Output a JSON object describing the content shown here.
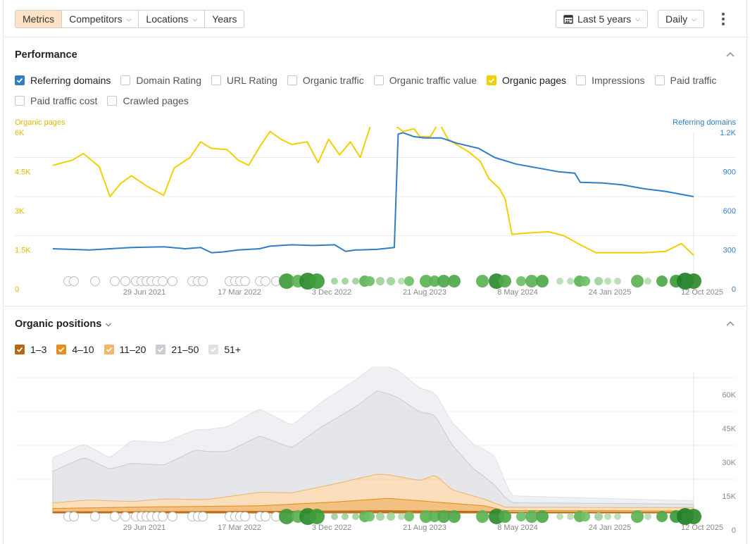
{
  "toolbar": {
    "tabs": [
      "Metrics",
      "Competitors",
      "Locations",
      "Years"
    ],
    "range_label": "Last 5 years",
    "interval_label": "Daily"
  },
  "performance": {
    "title": "Performance",
    "checkboxes": [
      {
        "label": "Referring domains",
        "checked": true,
        "color": "#2f7ec5"
      },
      {
        "label": "Domain Rating",
        "checked": false
      },
      {
        "label": "URL Rating",
        "checked": false
      },
      {
        "label": "Organic traffic",
        "checked": false
      },
      {
        "label": "Organic traffic value",
        "checked": false
      },
      {
        "label": "Organic pages",
        "checked": true,
        "color": "#f2cf00"
      },
      {
        "label": "Impressions",
        "checked": false
      },
      {
        "label": "Paid traffic",
        "checked": false
      },
      {
        "label": "Paid traffic cost",
        "checked": false
      },
      {
        "label": "Crawled pages",
        "checked": false
      }
    ]
  },
  "positions": {
    "title": "Organic positions",
    "legend": [
      {
        "label": "1–3",
        "color": "#b8660e"
      },
      {
        "label": "4–10",
        "color": "#e88e1c"
      },
      {
        "label": "11–20",
        "color": "#f7b56a"
      },
      {
        "label": "21–50",
        "color": "#c9ced6"
      },
      {
        "label": "51+",
        "color": "#dde1e7"
      }
    ]
  },
  "colors": {
    "organic_pages": "#f2cf00",
    "referring_domains": "#2f7ec5",
    "accent": "#fde3c4"
  },
  "chart_data": [
    {
      "type": "line",
      "left_axis_label": "Organic pages",
      "right_axis_label": "Referring domains",
      "x_tick_labels": [
        "29 Jun 2021",
        "17 Mar 2022",
        "3 Dec 2022",
        "21 Aug 2023",
        "8 May 2024",
        "24 Jan 2025",
        "12 Oct 2025"
      ],
      "y_left_ticks": [
        "0",
        "1.5K",
        "3K",
        "4.5K",
        "6K"
      ],
      "y_right_ticks": [
        "0",
        "300",
        "600",
        "900",
        "1.2K"
      ],
      "ylim_left": [
        0,
        6000
      ],
      "ylim_right": [
        0,
        1200
      ],
      "x_range": [
        "2020-10-20",
        "2025-10-20"
      ],
      "series": [
        {
          "name": "Organic pages",
          "axis": "left",
          "points": [
            [
              "2020-10-20",
              4200
            ],
            [
              "2020-12-15",
              4400
            ],
            [
              "2021-01-15",
              4650
            ],
            [
              "2021-03-01",
              4150
            ],
            [
              "2021-04-01",
              3000
            ],
            [
              "2021-05-01",
              3500
            ],
            [
              "2021-06-01",
              3800
            ],
            [
              "2021-07-15",
              3400
            ],
            [
              "2021-09-01",
              3050
            ],
            [
              "2021-10-01",
              4100
            ],
            [
              "2021-11-15",
              4500
            ],
            [
              "2021-12-15",
              5100
            ],
            [
              "2022-01-15",
              4850
            ],
            [
              "2022-03-01",
              4800
            ],
            [
              "2022-04-01",
              4400
            ],
            [
              "2022-05-01",
              4200
            ],
            [
              "2022-06-01",
              4900
            ],
            [
              "2022-07-01",
              5500
            ],
            [
              "2022-08-01",
              5200
            ],
            [
              "2022-09-01",
              5000
            ],
            [
              "2022-10-15",
              5100
            ],
            [
              "2022-11-15",
              4300
            ],
            [
              "2022-12-15",
              5200
            ],
            [
              "2023-01-15",
              4600
            ],
            [
              "2023-02-15",
              5100
            ],
            [
              "2023-03-15",
              4500
            ],
            [
              "2023-04-15",
              5800
            ],
            [
              "2023-05-15",
              5900
            ],
            [
              "2023-06-15",
              5800
            ],
            [
              "2023-07-15",
              5500
            ],
            [
              "2023-08-15",
              5600
            ],
            [
              "2023-09-01",
              5300
            ],
            [
              "2023-10-01",
              5300
            ],
            [
              "2023-10-25",
              5850
            ],
            [
              "2023-11-20",
              5200
            ],
            [
              "2023-12-20",
              4950
            ],
            [
              "2024-01-20",
              4700
            ],
            [
              "2024-02-20",
              4350
            ],
            [
              "2024-03-15",
              3700
            ],
            [
              "2024-04-15",
              3300
            ],
            [
              "2024-05-01",
              2900
            ],
            [
              "2024-05-20",
              1550
            ],
            [
              "2024-07-01",
              1600
            ],
            [
              "2024-09-01",
              1650
            ],
            [
              "2024-10-15",
              1500
            ],
            [
              "2024-12-01",
              1150
            ],
            [
              "2025-01-15",
              850
            ],
            [
              "2025-03-01",
              850
            ],
            [
              "2025-06-01",
              850
            ],
            [
              "2025-08-01",
              900
            ],
            [
              "2025-09-15",
              1200
            ],
            [
              "2025-10-20",
              750
            ]
          ]
        },
        {
          "name": "Referring domains",
          "axis": "right",
          "points": [
            [
              "2020-10-20",
              200
            ],
            [
              "2021-02-01",
              190
            ],
            [
              "2021-04-01",
              200
            ],
            [
              "2021-06-01",
              210
            ],
            [
              "2021-09-01",
              215
            ],
            [
              "2021-11-01",
              200
            ],
            [
              "2021-12-15",
              210
            ],
            [
              "2022-01-15",
              170
            ],
            [
              "2022-02-15",
              175
            ],
            [
              "2022-04-01",
              190
            ],
            [
              "2022-06-01",
              200
            ],
            [
              "2022-07-01",
              220
            ],
            [
              "2022-09-01",
              230
            ],
            [
              "2022-11-01",
              225
            ],
            [
              "2023-01-01",
              230
            ],
            [
              "2023-02-01",
              180
            ],
            [
              "2023-03-01",
              190
            ],
            [
              "2023-05-01",
              195
            ],
            [
              "2023-06-20",
              210
            ],
            [
              "2023-07-01",
              1080
            ],
            [
              "2023-07-15",
              1090
            ],
            [
              "2023-08-15",
              1060
            ],
            [
              "2023-09-15",
              1050
            ],
            [
              "2023-11-01",
              1050
            ],
            [
              "2023-12-15",
              1010
            ],
            [
              "2024-02-15",
              970
            ],
            [
              "2024-04-01",
              900
            ],
            [
              "2024-06-01",
              850
            ],
            [
              "2024-08-01",
              820
            ],
            [
              "2024-10-01",
              790
            ],
            [
              "2024-11-15",
              780
            ],
            [
              "2024-12-01",
              710
            ],
            [
              "2025-02-01",
              705
            ],
            [
              "2025-04-01",
              690
            ],
            [
              "2025-06-01",
              660
            ],
            [
              "2025-08-01",
              640
            ],
            [
              "2025-10-20",
              600
            ]
          ]
        }
      ]
    },
    {
      "type": "area",
      "stacked": true,
      "x_tick_labels": [
        "29 Jun 2021",
        "17 Mar 2022",
        "3 Dec 2022",
        "21 Aug 2023",
        "8 May 2024",
        "24 Jan 2025",
        "12 Oct 2025"
      ],
      "y_right_ticks": [
        "0",
        "15K",
        "30K",
        "45K",
        "60K"
      ],
      "ylim": [
        0,
        60000
      ],
      "x_range": [
        "2020-10-20",
        "2025-10-20"
      ],
      "series": [
        {
          "name": "1–3",
          "points": [
            [
              "2020-10-20",
              500
            ],
            [
              "2022-06-01",
              700
            ],
            [
              "2023-06-01",
              1000
            ],
            [
              "2024-03-01",
              700
            ],
            [
              "2024-05-01",
              300
            ],
            [
              "2025-10-20",
              300
            ]
          ]
        },
        {
          "name": "4–10",
          "points": [
            [
              "2020-10-20",
              1500
            ],
            [
              "2021-06-01",
              2000
            ],
            [
              "2022-06-01",
              2500
            ],
            [
              "2023-01-01",
              4000
            ],
            [
              "2023-06-01",
              5500
            ],
            [
              "2023-09-01",
              4500
            ],
            [
              "2024-03-01",
              2500
            ],
            [
              "2024-05-01",
              800
            ],
            [
              "2025-10-20",
              600
            ]
          ]
        },
        {
          "name": "11–20",
          "points": [
            [
              "2020-10-20",
              2500
            ],
            [
              "2021-02-01",
              3500
            ],
            [
              "2021-06-01",
              2500
            ],
            [
              "2021-09-01",
              3500
            ],
            [
              "2022-01-01",
              3000
            ],
            [
              "2022-06-01",
              6000
            ],
            [
              "2022-09-01",
              5000
            ],
            [
              "2023-01-01",
              8000
            ],
            [
              "2023-05-01",
              11000
            ],
            [
              "2023-09-01",
              9000
            ],
            [
              "2023-10-15",
              12000
            ],
            [
              "2023-12-01",
              6000
            ],
            [
              "2024-03-01",
              3000
            ],
            [
              "2024-05-01",
              1500
            ],
            [
              "2025-10-20",
              1500
            ]
          ]
        },
        {
          "name": "21–50",
          "points": [
            [
              "2020-10-20",
              14000
            ],
            [
              "2021-01-15",
              19000
            ],
            [
              "2021-04-01",
              14000
            ],
            [
              "2021-06-01",
              17000
            ],
            [
              "2021-09-01",
              15000
            ],
            [
              "2021-12-01",
              22000
            ],
            [
              "2022-03-01",
              20000
            ],
            [
              "2022-06-01",
              25000
            ],
            [
              "2022-09-01",
              20000
            ],
            [
              "2022-12-01",
              27000
            ],
            [
              "2023-03-01",
              32000
            ],
            [
              "2023-05-01",
              37000
            ],
            [
              "2023-07-01",
              35000
            ],
            [
              "2023-10-01",
              28000
            ],
            [
              "2023-12-01",
              20000
            ],
            [
              "2024-02-01",
              12000
            ],
            [
              "2024-04-01",
              8000
            ],
            [
              "2024-05-20",
              2000
            ],
            [
              "2025-10-20",
              1500
            ]
          ]
        },
        {
          "name": "51+",
          "points": [
            [
              "2020-10-20",
              6000
            ],
            [
              "2021-01-15",
              6000
            ],
            [
              "2021-04-01",
              5000
            ],
            [
              "2021-06-01",
              10000
            ],
            [
              "2021-09-01",
              10000
            ],
            [
              "2021-12-01",
              9000
            ],
            [
              "2022-03-01",
              11000
            ],
            [
              "2022-06-01",
              12000
            ],
            [
              "2022-09-01",
              10000
            ],
            [
              "2022-12-01",
              11000
            ],
            [
              "2023-03-01",
              12000
            ],
            [
              "2023-05-01",
              12000
            ],
            [
              "2023-07-01",
              12000
            ],
            [
              "2023-10-01",
              10000
            ],
            [
              "2023-12-01",
              10000
            ],
            [
              "2024-02-01",
              11000
            ],
            [
              "2024-04-01",
              13000
            ],
            [
              "2024-05-20",
              3000
            ],
            [
              "2025-10-20",
              1500
            ]
          ]
        }
      ]
    }
  ]
}
